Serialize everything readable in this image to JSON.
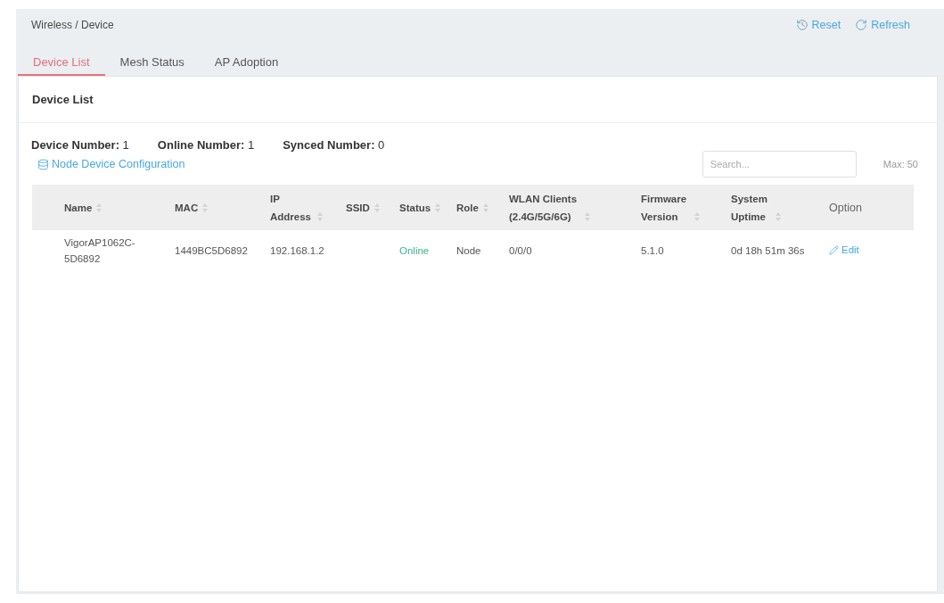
{
  "breadcrumb": "Wireless / Device",
  "header_actions": [
    {
      "kind": "reset",
      "label": "Reset"
    },
    {
      "kind": "refresh",
      "label": "Refresh"
    }
  ],
  "tabs": [
    {
      "label": "Device List",
      "selected": true
    },
    {
      "label": "Mesh Status",
      "selected": false
    },
    {
      "label": "AP Adoption",
      "selected": false
    }
  ],
  "panel": {
    "title": "Device List",
    "summary": [
      "**Device Number:** 1",
      "**Online Number:** 1",
      "**Synced Number:** 0"
    ],
    "config_link": "Node Device Configuration",
    "search": {
      "placeholder": "Search..."
    },
    "limit_note": "Max: 50",
    "table": {
      "columns": [
        {
          "label": "Name",
          "sortable": true
        },
        {
          "label": "MAC",
          "sortable": true
        },
        {
          "label": "IP Address",
          "sortable": true
        },
        {
          "label": "SSID",
          "sortable": true
        },
        {
          "label": "Status",
          "sortable": true
        },
        {
          "label": "Role",
          "sortable": true
        },
        {
          "label": "WLAN Clients (2.4G/5G/6G)",
          "sortable": true
        },
        {
          "label": "Firmware Version",
          "sortable": true
        },
        {
          "label": "System Uptime",
          "sortable": true
        },
        {
          "label": "Option",
          "sortable": false
        }
      ],
      "rows": [
        {
          "name": "VigorAP1062C-5D6892",
          "mac": "1449BC5D6892",
          "ip_address": "192.168.1.2",
          "status": "Online",
          "online": true,
          "role": "Node",
          "wlan_clients": "0/0/0",
          "firmware_version": "5.1.0",
          "system_uptime": "0d 18h 51m 36s",
          "option": "Edit"
        }
      ]
    }
  }
}
